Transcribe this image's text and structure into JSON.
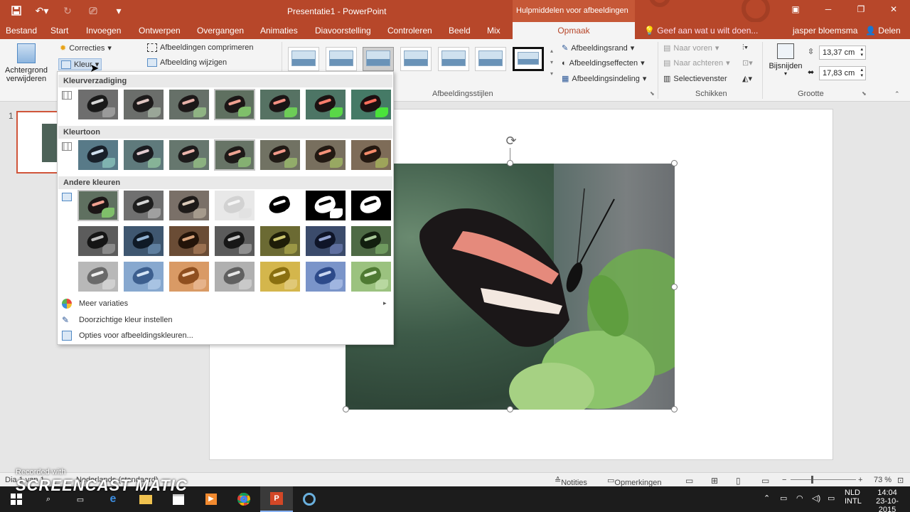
{
  "window": {
    "title": "Presentatie1 - PowerPoint",
    "context_header": "Hulpmiddelen voor afbeeldingen"
  },
  "tabs": [
    "Bestand",
    "Start",
    "Invoegen",
    "Ontwerpen",
    "Overgangen",
    "Animaties",
    "Diavoorstelling",
    "Controleren",
    "Beeld",
    "Mix",
    "Opmaak"
  ],
  "tell_me": "Geef aan wat u wilt doen...",
  "user": "jasper bloemsma",
  "share": "Delen",
  "ribbon": {
    "remove_bg_line1": "Achtergrond",
    "remove_bg_line2": "verwijderen",
    "corrections": "Correcties",
    "color": "Kleur",
    "compress": "Afbeeldingen comprimeren",
    "change_picture": "Afbeelding wijzigen",
    "picture_border": "Afbeeldingsrand",
    "picture_effects": "Afbeeldingseffecten",
    "picture_layout": "Afbeeldingsindeling",
    "styles_group": "Afbeeldingsstijlen",
    "bring_forward": "Naar voren",
    "send_backward": "Naar achteren",
    "selection_pane": "Selectievenster",
    "arrange_group": "Schikken",
    "crop": "Bijsnijden",
    "height": "13,37 cm",
    "width": "17,83 cm",
    "size_group": "Grootte"
  },
  "color_menu": {
    "saturation_header": "Kleurverzadiging",
    "tone_header": "Kleurtoon",
    "recolor_header": "Andere kleuren",
    "more_variations": "Meer variaties",
    "set_transparent": "Doorzichtige kleur instellen",
    "options": "Opties voor afbeeldingskleuren..."
  },
  "slides": {
    "number": "1"
  },
  "status": {
    "slide_info": "Dia 1 van 1",
    "language": "Nederlands (standaard)",
    "notes": "Notities",
    "comments": "Opmerkingen",
    "zoom": "73 %"
  },
  "taskbar": {
    "lang1": "NLD",
    "lang2": "INTL",
    "time": "14:04",
    "date": "23-10-2015"
  },
  "watermark": {
    "line1": "Recorded with",
    "line2": "SCREENCAST  MATIC"
  }
}
